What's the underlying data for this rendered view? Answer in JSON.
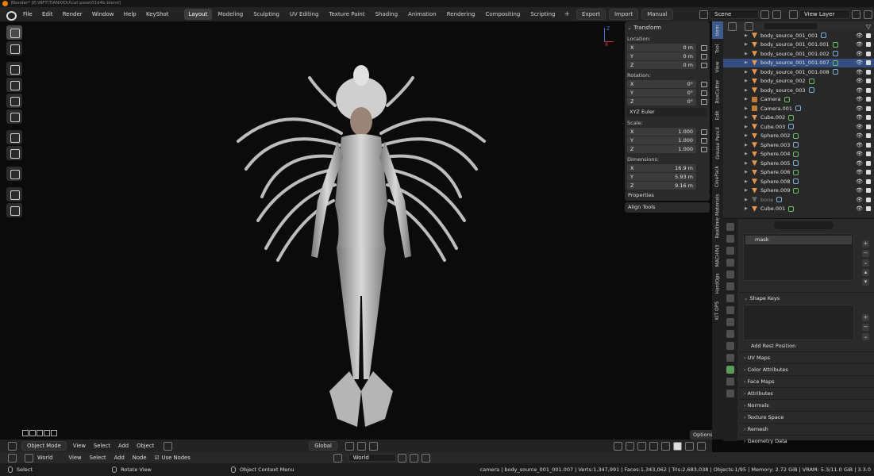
{
  "window": {
    "title": "Blender* [E:\\NFT\\TIANXIDU\\cat pose\\01d4b.blend]"
  },
  "menus": [
    "File",
    "Edit",
    "Render",
    "Window",
    "Help",
    "KeyShot"
  ],
  "workspaces": [
    "Layout",
    "Modeling",
    "Sculpting",
    "UV Editing",
    "Texture Paint",
    "Shading",
    "Animation",
    "Rendering",
    "Compositing",
    "Scripting"
  ],
  "active_workspace": "Layout",
  "addon_buttons": [
    "Export",
    "Import",
    "Manual"
  ],
  "scene": {
    "name": "Scene",
    "view_layer": "View Layer"
  },
  "npanel": {
    "title": "Transform",
    "location_label": "Location:",
    "location": [
      {
        "axis": "X",
        "value": "0 m"
      },
      {
        "axis": "Y",
        "value": "0 m"
      },
      {
        "axis": "Z",
        "value": "0 m"
      }
    ],
    "rotation_label": "Rotation:",
    "rotation": [
      {
        "axis": "X",
        "value": "0°"
      },
      {
        "axis": "Y",
        "value": "0°"
      },
      {
        "axis": "Z",
        "value": "0°"
      }
    ],
    "rotation_mode": "XYZ Euler",
    "scale_label": "Scale:",
    "scale": [
      {
        "axis": "X",
        "value": "1.000"
      },
      {
        "axis": "Y",
        "value": "1.000"
      },
      {
        "axis": "Z",
        "value": "1.000"
      }
    ],
    "dimensions_label": "Dimensions:",
    "dimensions": [
      {
        "axis": "X",
        "value": "16.9 m"
      },
      {
        "axis": "Y",
        "value": "5.93 m"
      },
      {
        "axis": "Z",
        "value": "9.16 m"
      }
    ],
    "properties_label": "Properties",
    "align_label": "Align Tools"
  },
  "sidebar_tabs": [
    "Item",
    "Tool",
    "View",
    "BoxCutter",
    "Edit",
    "Grease Pencil",
    "CinePack",
    "Realtime Materials",
    "MACHIN3",
    "HardOps",
    "KIT OPS"
  ],
  "outliner": [
    {
      "name": "body_source_001_001",
      "icon": "mesh",
      "selected": false
    },
    {
      "name": "body_source_001_001.001",
      "icon": "mesh",
      "selected": false
    },
    {
      "name": "body_source_001_001.002",
      "icon": "mesh",
      "selected": false
    },
    {
      "name": "body_source_001_001.007",
      "icon": "mesh",
      "selected": true
    },
    {
      "name": "body_source_001_001.008",
      "icon": "mesh",
      "selected": false
    },
    {
      "name": "body_source_002",
      "icon": "mesh",
      "selected": false
    },
    {
      "name": "body_source_003",
      "icon": "mesh",
      "selected": false
    },
    {
      "name": "Camera",
      "icon": "camera",
      "selected": false
    },
    {
      "name": "Camera.001",
      "icon": "camera",
      "selected": false
    },
    {
      "name": "Cube.002",
      "icon": "mesh",
      "selected": false
    },
    {
      "name": "Cube.003",
      "icon": "mesh",
      "selected": false
    },
    {
      "name": "Sphere.002",
      "icon": "mesh",
      "selected": false
    },
    {
      "name": "Sphere.003",
      "icon": "mesh",
      "selected": false
    },
    {
      "name": "Sphere.004",
      "icon": "mesh",
      "selected": false
    },
    {
      "name": "Sphere.005",
      "icon": "mesh",
      "selected": false
    },
    {
      "name": "Sphere.006",
      "icon": "mesh",
      "selected": false
    },
    {
      "name": "Sphere.008",
      "icon": "mesh",
      "selected": false
    },
    {
      "name": "Sphere.009",
      "icon": "mesh",
      "selected": false
    },
    {
      "name": "bone",
      "icon": "bone",
      "selected": false
    },
    {
      "name": "Cube.001",
      "icon": "mesh",
      "selected": false
    }
  ],
  "properties": {
    "vertex_group": "mask",
    "shape_keys_label": "Shape Keys",
    "add_rest_position": "Add Rest Position",
    "sections": [
      "UV Maps",
      "Color Attributes",
      "Face Maps",
      "Attributes",
      "Normals",
      "Texture Space",
      "Remesh",
      "Geometry Data"
    ]
  },
  "viewport_header": {
    "mode": "Object Mode",
    "menus": [
      "View",
      "Select",
      "Add",
      "Object"
    ],
    "transform": "Global",
    "options": "Options"
  },
  "editor_header": {
    "world": "World",
    "menus": [
      "View",
      "Select",
      "Add",
      "Node"
    ],
    "use_nodes": "Use Nodes",
    "world2": "World"
  },
  "status": {
    "select": "Select",
    "rotate": "Rotate View",
    "context": "Object Context Menu",
    "info": "camera | body_source_001_001.007 | Verts:1,347,991 | Faces:1,343,062 | Tris:2,683,038 | Objects:1/95 | Memory: 2.72 GiB | VRAM: 5.3/11.0 GiB | 3.3.0"
  },
  "colors": {
    "accent": "#e87d0d",
    "selection": "#334d80",
    "mesh_icon": "#e59550",
    "x_axis": "#c8343c",
    "z_axis": "#3c6fd6"
  }
}
